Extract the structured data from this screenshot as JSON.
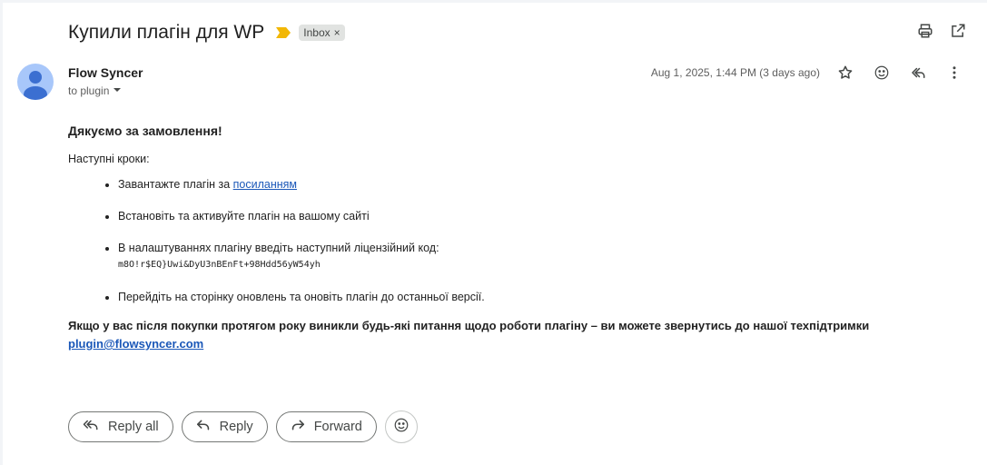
{
  "email": {
    "subject": "Купили плагін для WP",
    "label": "Inbox",
    "label_remove": "×",
    "sender": "Flow Syncer",
    "recipient": "to plugin",
    "date": "Aug 1, 2025, 1:44 PM (3 days ago)"
  },
  "body": {
    "greeting": "Дякуємо за замовлення!",
    "next_steps": "Наступні кроки:",
    "step1_text": "Завантажте плагін за ",
    "step1_link": "посиланням",
    "step2": "Встановіть та активуйте плагін на вашому сайті",
    "step3": "В налаштуваннях плагіну введіть наступний ліцензійний код:",
    "license_code": "m8O!r$EQ}Uwi&DyU3nBEnFt+98Hdd56yW54yh",
    "step4": "Перейдіть на сторінку оновлень та оновіть плагін до останньої версії.",
    "support_text": "Якщо у вас після покупки протягом року виникли будь-які питання щодо роботи плагіну – ви можете звернутись до нашої техпідтримки",
    "support_email": "plugin@flowsyncer.com"
  },
  "actions": {
    "reply_all": "Reply all",
    "reply": "Reply",
    "forward": "Forward"
  },
  "icons": {
    "importance": "importance-marker-icon",
    "print": "print-icon",
    "open_new": "open-in-new-window-icon",
    "star": "star-icon",
    "emoji": "emoji-icon",
    "reply": "reply-icon",
    "more": "more-vert-icon",
    "dropdown": "chevron-down-icon",
    "reply_all": "reply-all-icon",
    "forward": "forward-icon"
  },
  "colors": {
    "importance": "#f2b705",
    "link": "#1a57b8",
    "avatar": "#a8c7fa",
    "avatar_figure": "#3b6fd1"
  }
}
